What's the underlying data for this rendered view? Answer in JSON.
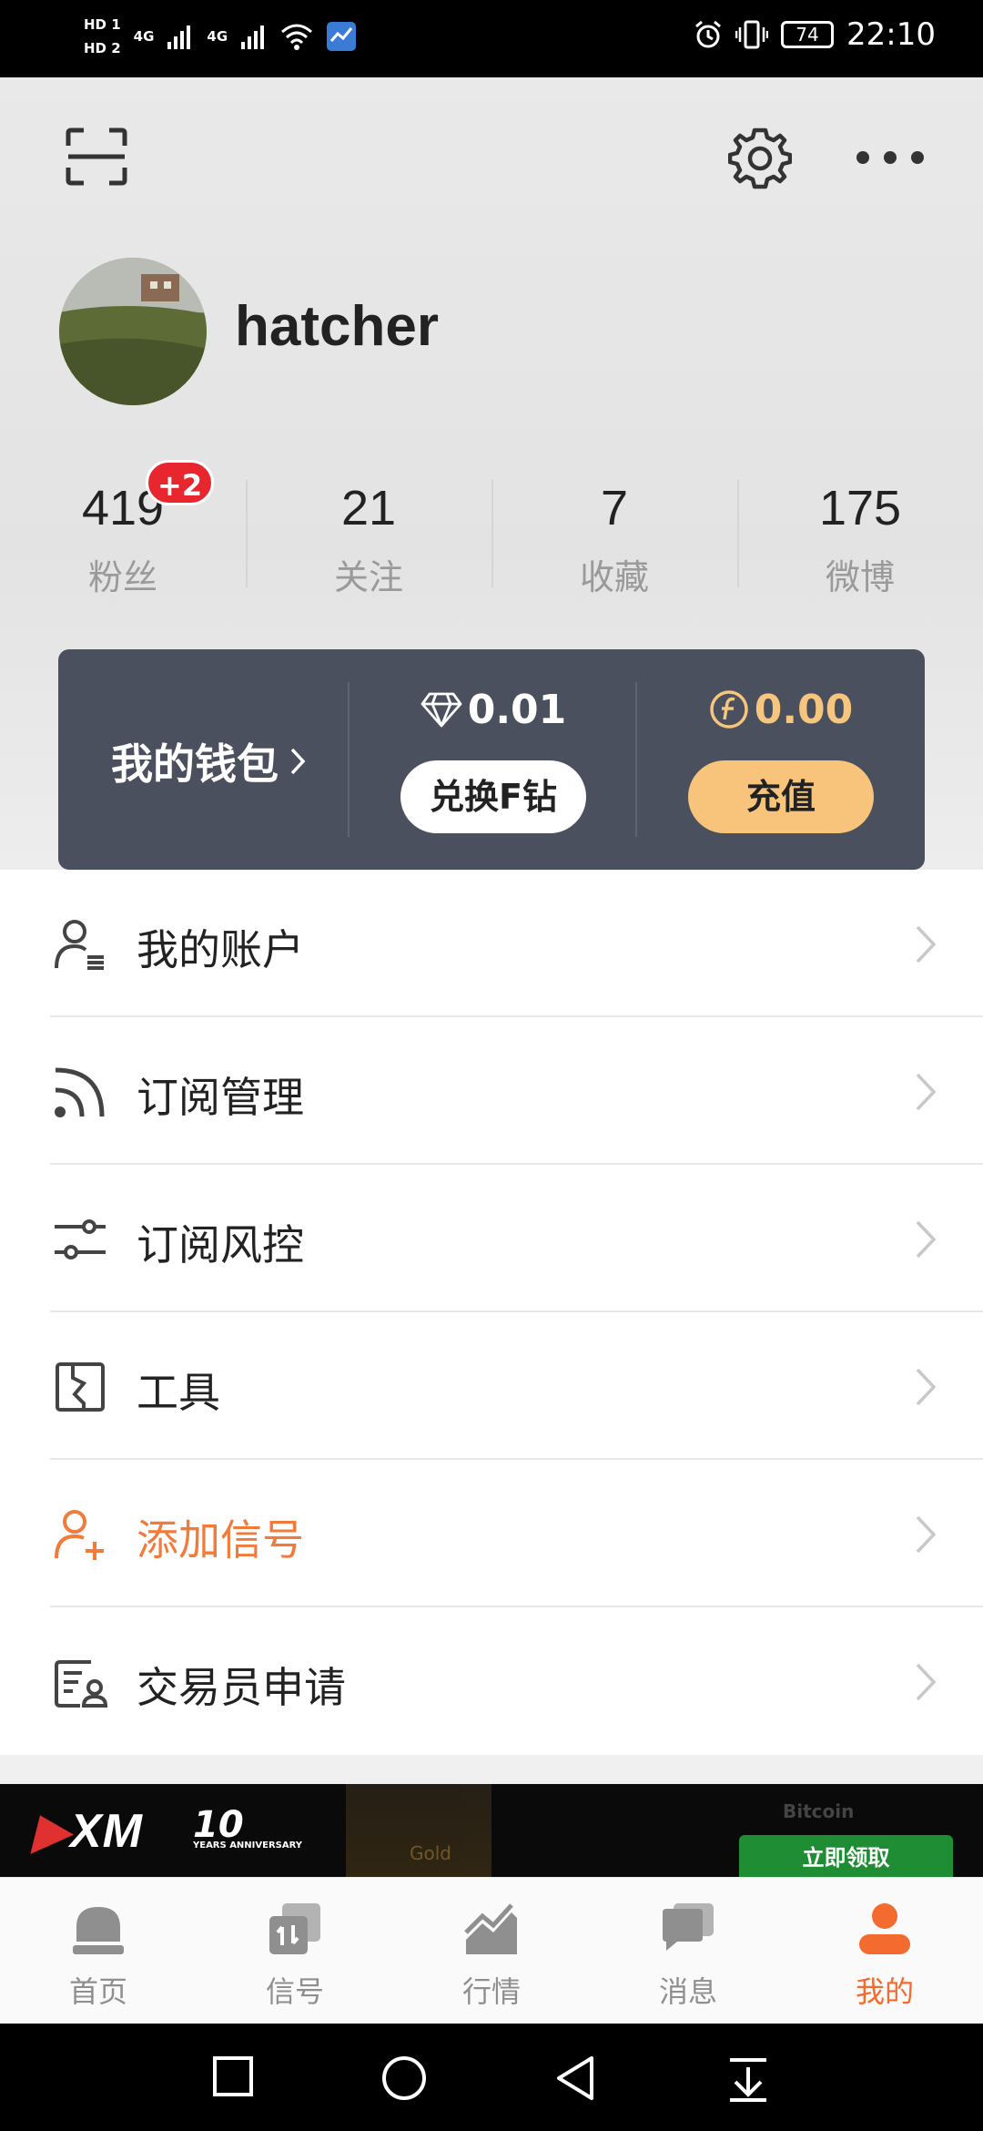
{
  "status_bar": {
    "sim1": "HD 1",
    "sim2": "HD 2",
    "network1": "4G",
    "network2": "4G",
    "battery": "74",
    "time": "22:10"
  },
  "profile": {
    "username": "hatcher",
    "stats": [
      {
        "value": "419",
        "label": "粉丝",
        "badge": "+2"
      },
      {
        "value": "21",
        "label": "关注"
      },
      {
        "value": "7",
        "label": "收藏"
      },
      {
        "value": "175",
        "label": "微博"
      }
    ]
  },
  "wallet": {
    "title": "我的钱包",
    "diamond_value": "0.01",
    "exchange_label": "兑换F钻",
    "coin_value": "0.00",
    "recharge_label": "充值"
  },
  "menu": [
    {
      "label": "我的账户",
      "icon": "account-icon"
    },
    {
      "label": "订阅管理",
      "icon": "rss-icon"
    },
    {
      "label": "订阅风控",
      "icon": "sliders-icon"
    },
    {
      "label": "工具",
      "icon": "tool-icon"
    },
    {
      "label": "添加信号",
      "icon": "add-user-icon"
    },
    {
      "label": "交易员申请",
      "icon": "id-card-icon"
    }
  ],
  "ad": {
    "brand": "XM",
    "anniversary": "10",
    "anniversary_sub": "YEARS ANNIVERSARY",
    "gold": "Gold",
    "bitcoin": "Bitcoin",
    "cta": "立即领取"
  },
  "bottom_nav": [
    {
      "label": "首页"
    },
    {
      "label": "信号"
    },
    {
      "label": "行情"
    },
    {
      "label": "消息"
    },
    {
      "label": "我的"
    }
  ],
  "colors": {
    "accent": "#f36b2e",
    "wallet_bg": "#4a505d",
    "gold": "#f8c47c"
  }
}
